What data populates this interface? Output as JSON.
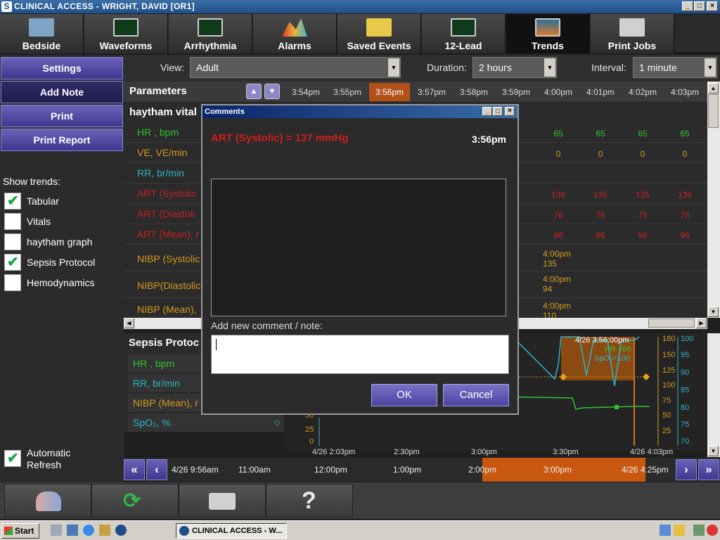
{
  "window": {
    "title": "CLINICAL ACCESS - WRIGHT, DAVID [OR1]"
  },
  "nav": {
    "tabs": [
      "Bedside",
      "Waveforms",
      "Arrhythmia",
      "Alarms",
      "Saved Events",
      "12-Lead",
      "Trends",
      "Print Jobs"
    ],
    "active": "Trends"
  },
  "left": {
    "buttons": [
      "Settings",
      "Add Note",
      "Print",
      "Print Report"
    ],
    "show_trends_label": "Show trends:",
    "trends": [
      {
        "label": "Tabular",
        "checked": true
      },
      {
        "label": "Vitals",
        "checked": false
      },
      {
        "label": "haytham graph",
        "checked": false
      },
      {
        "label": "Sepsis Protocol",
        "checked": true
      },
      {
        "label": "Hemodynamics",
        "checked": false
      }
    ],
    "auto_refresh": {
      "label_line1": "Automatic",
      "label_line2": "Refresh",
      "checked": true
    }
  },
  "toolbar": {
    "view_label": "View:",
    "view_value": "Adult",
    "duration_label": "Duration:",
    "duration_value": "2 hours",
    "interval_label": "Interval:",
    "interval_value": "1 minute"
  },
  "params": {
    "title": "Parameters",
    "group": "haytham vital",
    "times": [
      "3:54pm",
      "3:55pm",
      "3:56pm",
      "3:57pm",
      "3:58pm",
      "3:59pm",
      "4:00pm",
      "4:01pm",
      "4:02pm",
      "4:03pm"
    ],
    "rows": [
      {
        "name": "HR , bpm",
        "color": "#31c231",
        "values": [
          "65",
          "65",
          "65",
          "65"
        ],
        "partial": "5"
      },
      {
        "name": "VE, VE/min",
        "color": "#d49a1e",
        "values": [
          "0",
          "0",
          "0",
          "0"
        ],
        "partial": ""
      },
      {
        "name": "RR, br/min",
        "color": "#2bb5c8",
        "values": [],
        "partial": ""
      },
      {
        "name": "ART (Systolic",
        "color": "#c42121",
        "values": [
          "136",
          "135",
          "135",
          "136"
        ],
        "partial": "6"
      },
      {
        "name": "ART (Diastoli",
        "color": "#c42121",
        "values": [
          "76",
          "75",
          "75",
          "75"
        ],
        "partial": ""
      },
      {
        "name": "ART (Mean), r",
        "color": "#c42121",
        "values": [
          "96",
          "96",
          "96",
          "96"
        ],
        "partial": "6"
      }
    ],
    "nibp": [
      {
        "name": "NIBP (Systolic",
        "time": "4:00pm",
        "value": "135"
      },
      {
        "name": "NIBP(Diastolic",
        "time": "4:00pm",
        "value": "94"
      },
      {
        "name": "NIBP (Mean),",
        "time": "4:00pm",
        "value": "110"
      }
    ]
  },
  "sepsis": {
    "title": "Sepsis Protoc",
    "rows": [
      {
        "name": "HR , bpm",
        "color": "#31c231"
      },
      {
        "name": "RR, br/min",
        "color": "#2bb5c8"
      },
      {
        "name": "NIBP (Mean), r",
        "color": "#d49a1e"
      },
      {
        "name": "SpO₂, %",
        "color": "#2bb5c8"
      }
    ]
  },
  "graph": {
    "tooltip": {
      "time": "4/26 3:56:00pm",
      "hr": "HR =65",
      "spo2": "SpO₂=100"
    },
    "axis_orange": [
      "180",
      "150",
      "125",
      "100",
      "75",
      "50",
      "25"
    ],
    "axis_cyan": [
      "100",
      "95",
      "90",
      "85",
      "80",
      "75",
      "70"
    ],
    "left_axis": [
      "50",
      "25",
      "0"
    ],
    "x_labels": [
      "4/26 2:03pm",
      "2:30pm",
      "3:00pm",
      "3:30pm",
      "4/26 4:03pm"
    ]
  },
  "timeline": {
    "labels": [
      "4/26 9:56am",
      "11:00am",
      "12:00pm",
      "1:00pm",
      "2:00pm",
      "3:00pm",
      "4/26 4:25pm"
    ]
  },
  "dialog": {
    "title": "Comments",
    "measurement": "ART (Systolic) = 137 mmHg",
    "time": "3:56pm",
    "note_label": "Add new comment / note:",
    "note_value": "",
    "ok": "OK",
    "cancel": "Cancel"
  },
  "taskbar": {
    "start": "Start",
    "task": "CLINICAL ACCESS - W..."
  }
}
